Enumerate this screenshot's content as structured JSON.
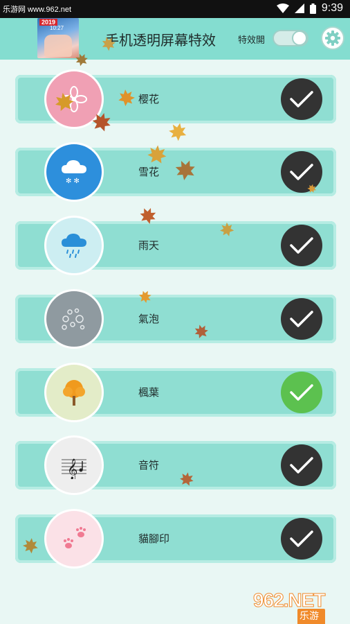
{
  "status_bar": {
    "site": "乐游网 www.962.net",
    "time": "9:39"
  },
  "header": {
    "thumbnail": {
      "year": "2019",
      "time": "10:27"
    },
    "title": "手机透明屏幕特效",
    "toggle_label": "特效開",
    "toggle_on": true,
    "settings_icon": "gear-icon"
  },
  "effects": [
    {
      "label": "樱花",
      "icon": "sakura-icon",
      "color": "#f0a0b4",
      "checked": false
    },
    {
      "label": "雪花",
      "icon": "snow-cloud-icon",
      "color": "#2d8fdc",
      "checked": false
    },
    {
      "label": "雨天",
      "icon": "rain-cloud-icon",
      "color": "#cdeef2",
      "checked": false
    },
    {
      "label": "氣泡",
      "icon": "bubbles-icon",
      "color": "#8f9aa0",
      "checked": false
    },
    {
      "label": "楓葉",
      "icon": "maple-tree-icon",
      "color": "#e3ecc8",
      "checked": true
    },
    {
      "label": "音符",
      "icon": "music-note-icon",
      "color": "#eeeeee",
      "checked": false
    },
    {
      "label": "貓腳印",
      "icon": "paw-print-icon",
      "color": "#fbe1e7",
      "checked": false
    }
  ],
  "watermark": {
    "number": "962.NET",
    "text": "乐游网"
  },
  "colors": {
    "accent": "#84ddd0",
    "card": "#8fded2",
    "check_on": "#5cc14f",
    "check_off": "#333333"
  }
}
